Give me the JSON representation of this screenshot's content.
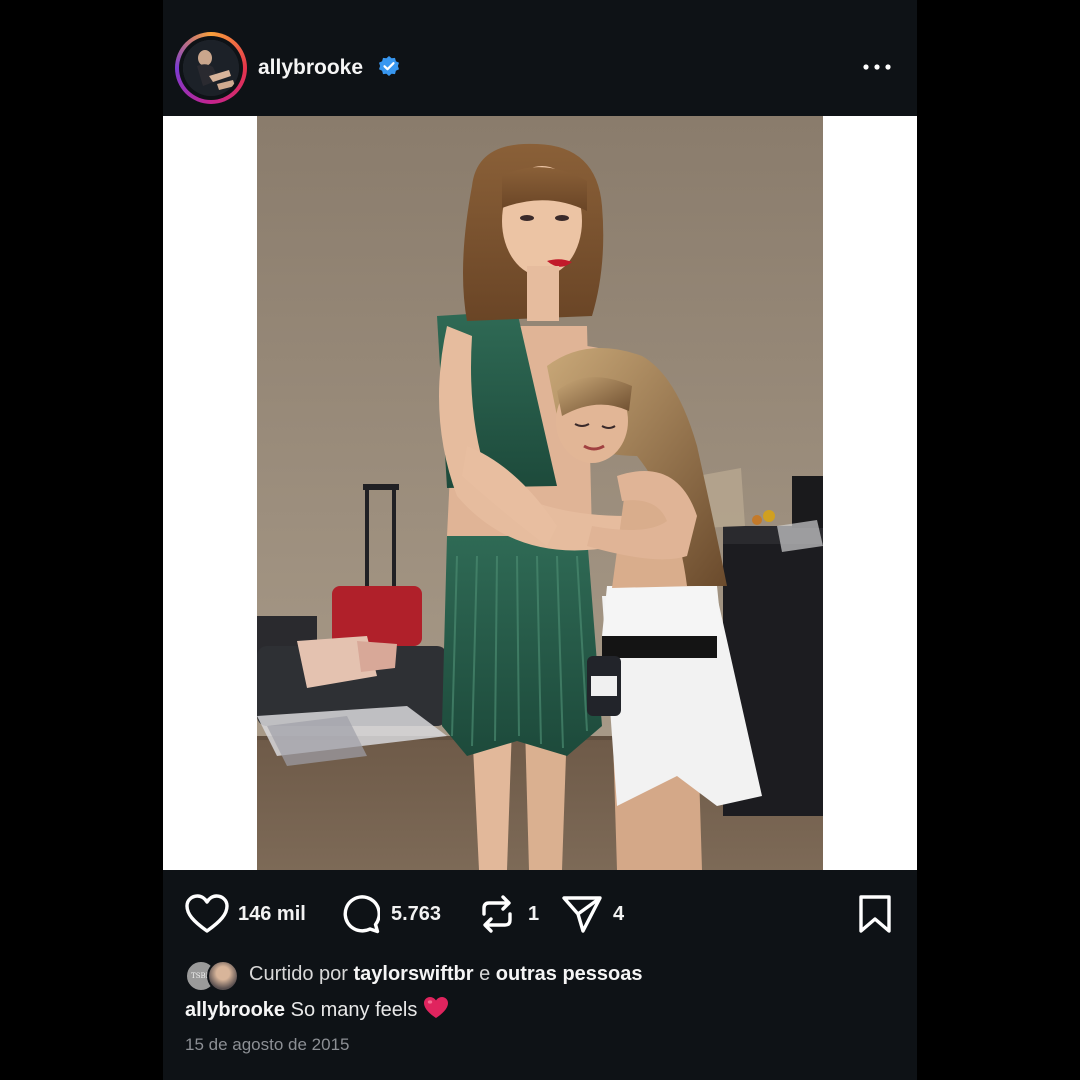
{
  "post": {
    "username": "allybrooke",
    "verified_icon": "verified-badge-icon",
    "more_icon": "more-options-icon",
    "photo_description_icon": "post-photo"
  },
  "actions": {
    "likes": "146 mil",
    "comments": "5.763",
    "reposts": "1",
    "shares": "4"
  },
  "liked_by": {
    "prefix": "Curtido por",
    "user": "taylorswiftbr",
    "conjunction": "e",
    "others": "outras pessoas",
    "mini_avatar_text": "TSBR"
  },
  "caption": {
    "username": "allybrooke",
    "text": "So many feels",
    "emoji": "❤️"
  },
  "date": "15 de agosto de 2015",
  "colors": {
    "background": "#000000",
    "post_bg": "#0e1216",
    "verified": "#3897f0",
    "heart": "#e0245e"
  }
}
